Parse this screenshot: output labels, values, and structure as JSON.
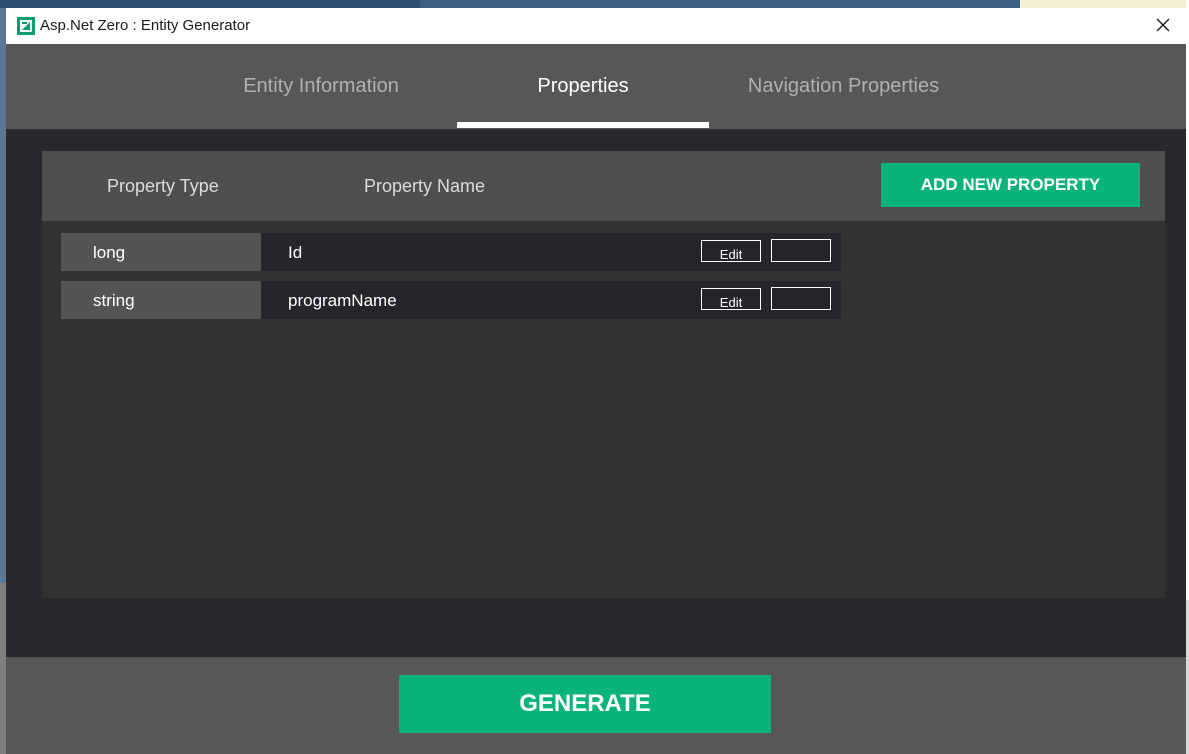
{
  "window": {
    "title": "Asp.Net Zero : Entity Generator",
    "app_icon": "asp-net-zero-logo",
    "close_icon": "close-icon"
  },
  "tabs": [
    {
      "label": "Entity Information",
      "active": false
    },
    {
      "label": "Properties",
      "active": true
    },
    {
      "label": "Navigation Properties",
      "active": false
    }
  ],
  "properties": {
    "column_headers": {
      "type": "Property Type",
      "name": "Property Name"
    },
    "add_button_label": "ADD NEW PROPERTY",
    "rows": [
      {
        "type": "long",
        "name": "Id",
        "edit_label": "Edit",
        "delete_label": ""
      },
      {
        "type": "string",
        "name": "programName",
        "edit_label": "Edit",
        "delete_label": ""
      }
    ]
  },
  "footer": {
    "generate_label": "GENERATE"
  },
  "colors": {
    "accent": "#0ab378",
    "tab_bar": "#575757",
    "window_bg": "#29292d",
    "panel_bg": "#323232",
    "row_type_bg": "#545454"
  }
}
